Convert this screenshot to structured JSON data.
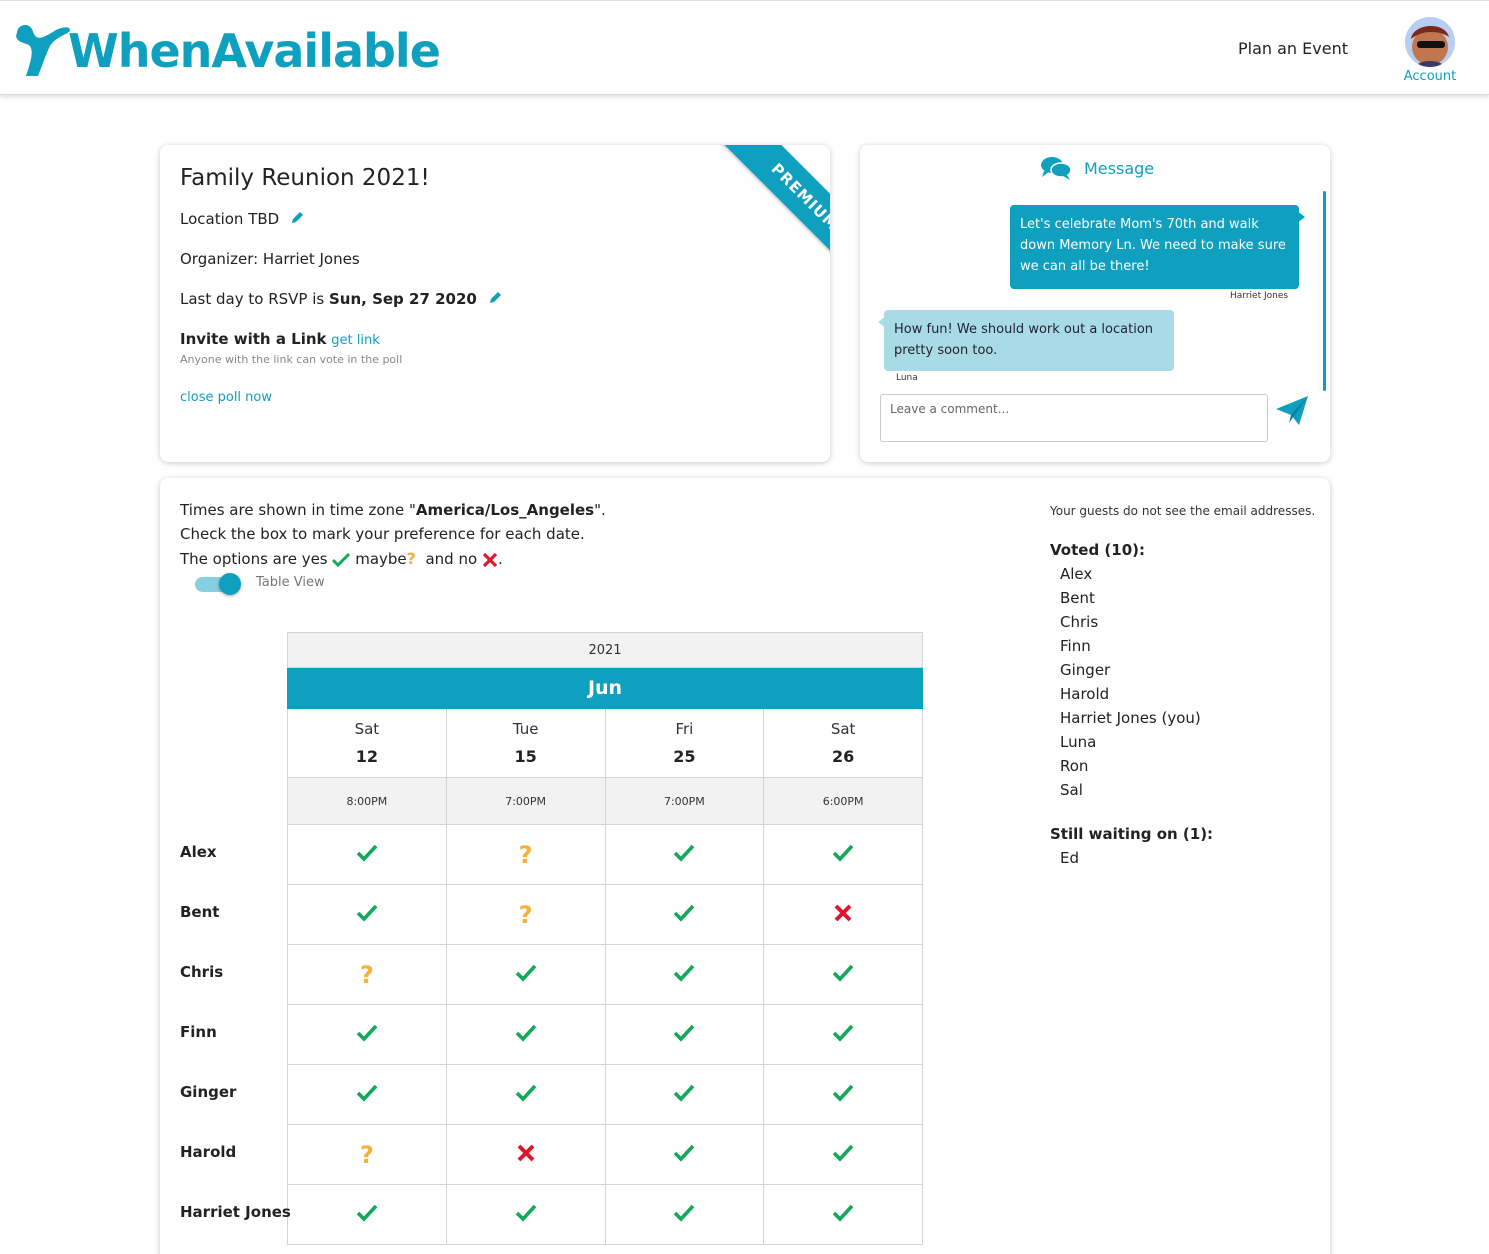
{
  "brand": {
    "name": "WhenAvailable",
    "color": "#0f9fbf"
  },
  "nav": {
    "plan_event": "Plan an Event",
    "account_label": "Account"
  },
  "event": {
    "title": "Family Reunion 2021!",
    "location": "Location TBD",
    "organizer": "Organizer: Harriet Jones",
    "rsvp_prefix": "Last day to RSVP is",
    "rsvp_date": "Sun, Sep 27 2020",
    "invite_label": "Invite with a Link",
    "get_link": "get link",
    "invite_note": "Anyone with the link can vote in the poll",
    "close_poll": "close poll now",
    "ribbon": "PREMIUM"
  },
  "messages": {
    "header": "Message",
    "items": [
      {
        "text": "Let's celebrate Mom's 70th and walk down Memory Ln. We need to make sure we can all be there!",
        "author": "Harriet Jones"
      },
      {
        "text": "How fun! We should work out a location pretty soon too.",
        "author": "Luna"
      }
    ],
    "input_placeholder": "Leave a comment..."
  },
  "poll": {
    "tz_prefix": "Times are shown in time zone \"",
    "tz_name": "America/Los_Angeles",
    "tz_suffix": "\".",
    "instruction": "Check the box to mark your preference for each date.",
    "options_prefix": "The options are yes",
    "options_maybe": "maybe",
    "options_and_no": "and no",
    "options_end": ".",
    "toggle_label": "Table View",
    "toggle_on": true,
    "year": "2021",
    "month": "Jun",
    "dates": [
      {
        "day": "Sat",
        "num": "12",
        "time": "8:00PM"
      },
      {
        "day": "Tue",
        "num": "15",
        "time": "7:00PM"
      },
      {
        "day": "Fri",
        "num": "25",
        "time": "7:00PM"
      },
      {
        "day": "Sat",
        "num": "26",
        "time": "6:00PM"
      }
    ],
    "rows": [
      {
        "name": "Alex",
        "votes": [
          "yes",
          "maybe",
          "yes",
          "yes"
        ]
      },
      {
        "name": "Bent",
        "votes": [
          "yes",
          "maybe",
          "yes",
          "no"
        ]
      },
      {
        "name": "Chris",
        "votes": [
          "maybe",
          "yes",
          "yes",
          "yes"
        ]
      },
      {
        "name": "Finn",
        "votes": [
          "yes",
          "yes",
          "yes",
          "yes"
        ]
      },
      {
        "name": "Ginger",
        "votes": [
          "yes",
          "yes",
          "yes",
          "yes"
        ]
      },
      {
        "name": "Harold",
        "votes": [
          "maybe",
          "no",
          "yes",
          "yes"
        ]
      },
      {
        "name": "Harriet Jones",
        "votes": [
          "yes",
          "yes",
          "yes",
          "yes"
        ]
      }
    ],
    "vote_colors": {
      "yes": "#13a85a",
      "maybe": "#f5b13d",
      "no": "#e0162b"
    }
  },
  "guests": {
    "note": "Your guests do not see the email addresses.",
    "voted_heading": "Voted (10):",
    "voted": [
      "Alex",
      "Bent",
      "Chris",
      "Finn",
      "Ginger",
      "Harold",
      "Harriet Jones (you)",
      "Luna",
      "Ron",
      "Sal"
    ],
    "waiting_heading": "Still waiting on (1):",
    "waiting": [
      "Ed"
    ]
  }
}
